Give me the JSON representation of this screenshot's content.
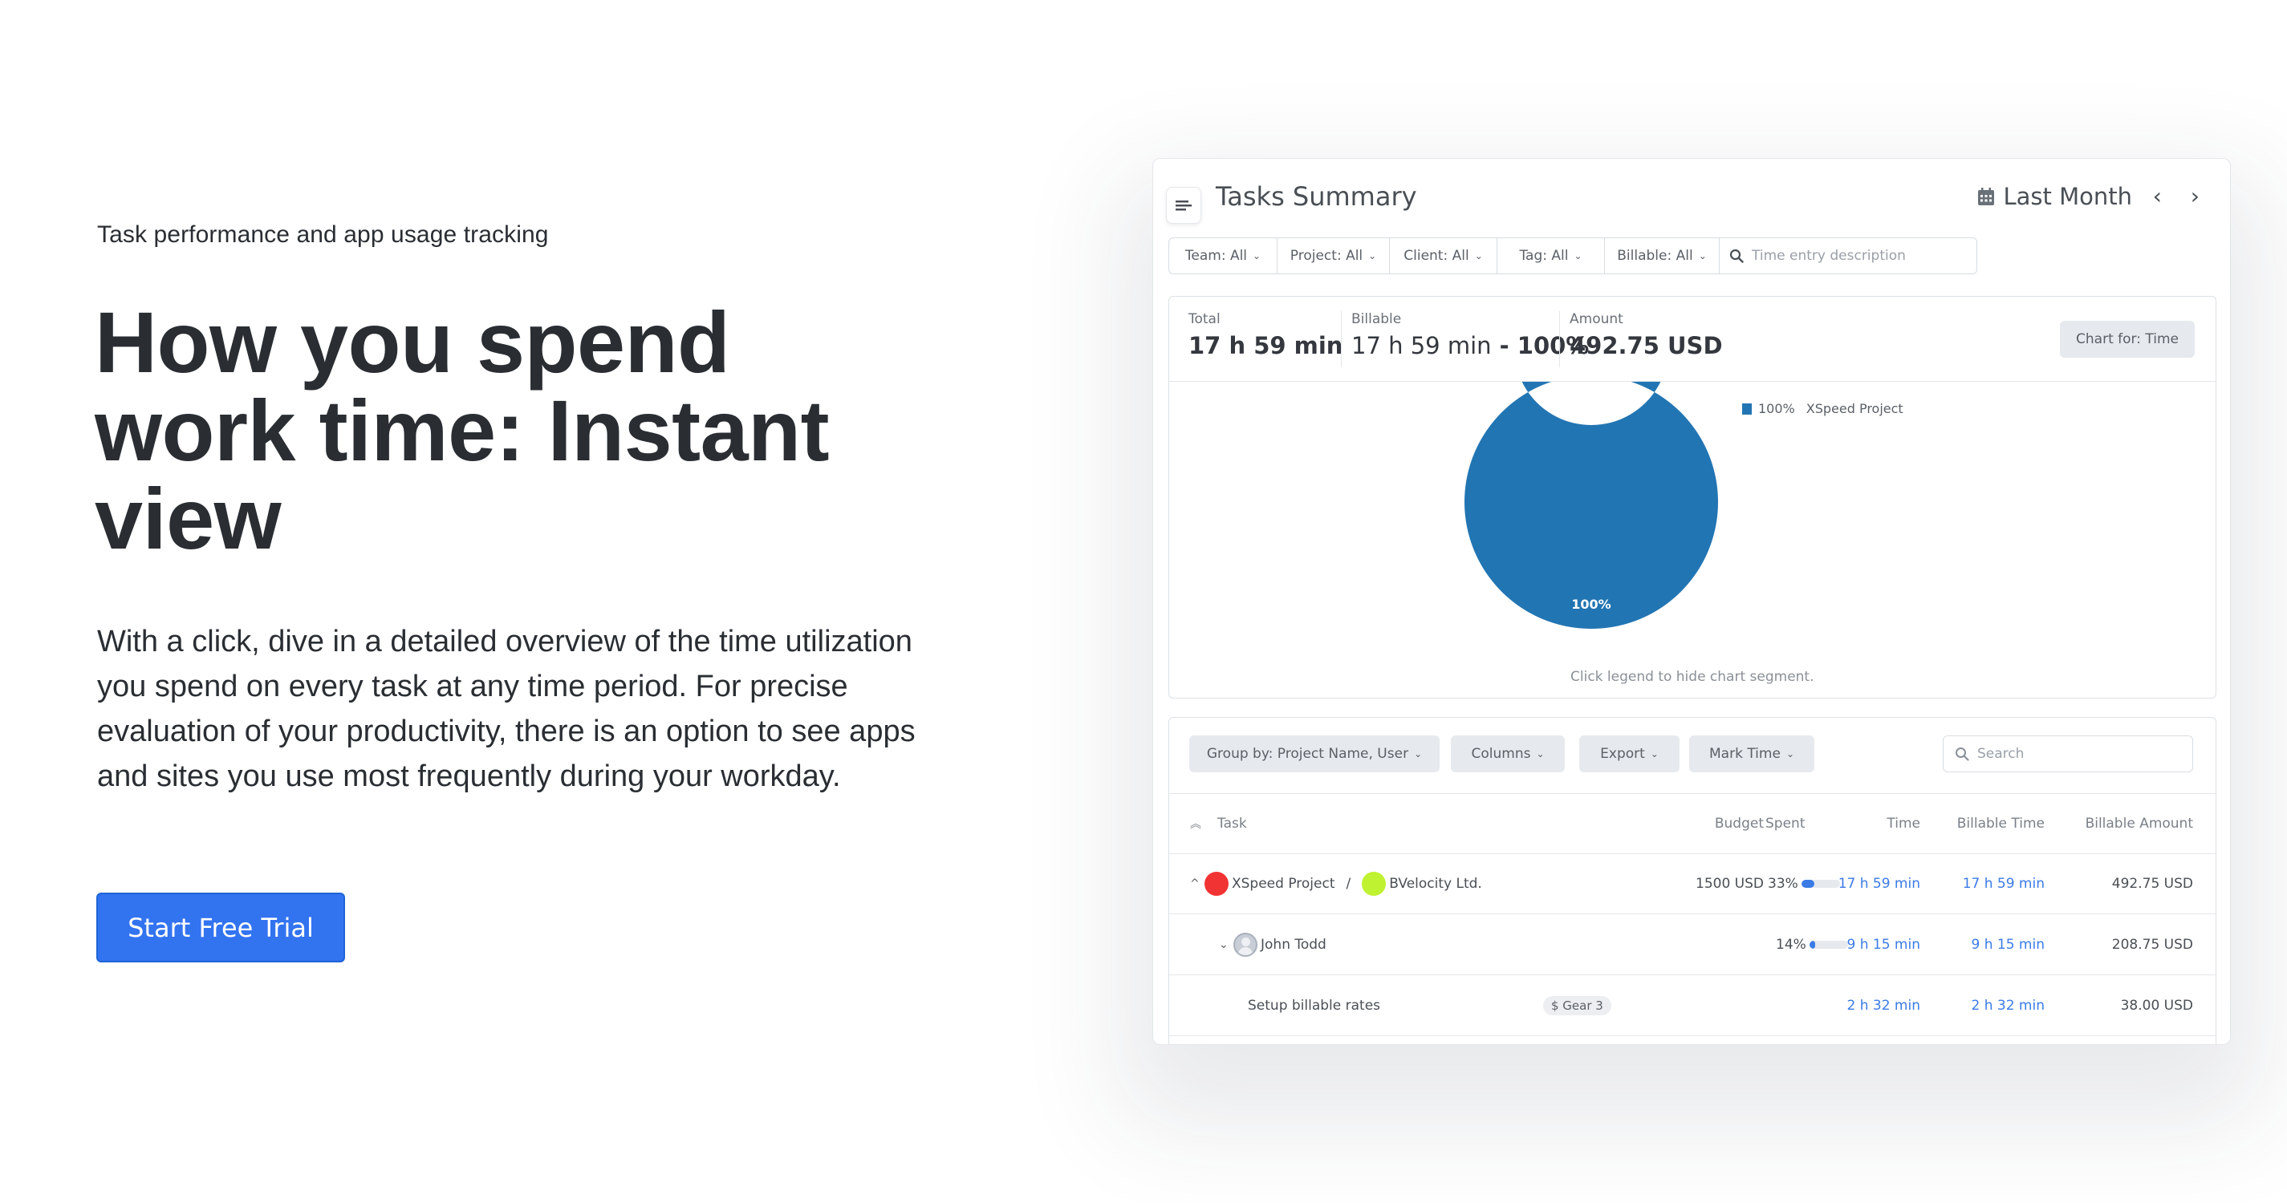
{
  "hero": {
    "eyebrow": "Task performance and app usage tracking",
    "headline_line1": "How you spend",
    "headline_line2": "work time: Instant",
    "headline_line3": "view",
    "description": "With a click, dive in a detailed overview of the time utilization you spend on every task at any time period. For precise evaluation of your productivity, there is an option to see apps and sites you use most frequently during your workday.",
    "cta_label": "Start Free Trial"
  },
  "colors": {
    "cta": "#3273f0",
    "accent_blue": "#3b7be6",
    "chart_blue": "#2275b3",
    "project_dot": "#f23333",
    "client_dot": "#bff231"
  },
  "app": {
    "title": "Tasks Summary",
    "menu_icon": "menu-icon",
    "period_icon": "calendar-icon",
    "period_label": "Last Month",
    "prev_glyph": "‹",
    "next_glyph": "›",
    "filters": [
      {
        "label": "Team: All"
      },
      {
        "label": "Project: All"
      },
      {
        "label": "Client: All"
      },
      {
        "label": "Tag: All"
      },
      {
        "label": "Billable: All"
      }
    ],
    "filter_search_placeholder": "Time entry description",
    "summary": {
      "total_label": "Total",
      "total_value": "17 h 59 min",
      "billable_label": "Billable",
      "billable_value": "17 h 59 min",
      "billable_separator": " - ",
      "billable_pct": "100%",
      "amount_label": "Amount",
      "amount_value": "492.75 USD",
      "chart_for_label": "Chart for: Time"
    },
    "chart_hint": "Click legend to hide chart segment.",
    "toolbar": {
      "group_by": "Group by: Project Name, User",
      "columns": "Columns",
      "export": "Export",
      "mark_time": "Mark Time",
      "search_placeholder": "Search"
    },
    "table": {
      "headers": {
        "task": "Task",
        "budget": "Budget",
        "spent": "Spent",
        "time": "Time",
        "billable_time": "Billable Time",
        "billable_amount": "Billable Amount"
      },
      "rows": [
        {
          "project": "XSpeed Project",
          "separator": "/",
          "client": "BVelocity Ltd.",
          "budget": "1500 USD",
          "spent_label": "33%",
          "spent_fraction": 0.33,
          "time": "17 h 59 min",
          "billable_time": "17 h 59 min",
          "billable_amount": "492.75 USD"
        },
        {
          "user": "John Todd",
          "spent_label": "14%",
          "spent_fraction": 0.14,
          "time": "9 h 15 min",
          "billable_time": "9 h 15 min",
          "billable_amount": "208.75 USD"
        },
        {
          "task": "Setup billable rates",
          "tag": "$ Gear 3",
          "time": "2 h 32 min",
          "billable_time": "2 h 32 min",
          "billable_amount": "38.00 USD"
        }
      ]
    }
  },
  "chart_data": {
    "type": "pie",
    "variant": "donut",
    "title": "",
    "categories": [
      "XSpeed Project"
    ],
    "values": [
      100
    ],
    "labels": [
      "100%"
    ],
    "legend": [
      {
        "label": "XSpeed Project",
        "pct": "100%"
      }
    ],
    "legend_position": "top-right",
    "colors": [
      "#2275b3"
    ]
  }
}
